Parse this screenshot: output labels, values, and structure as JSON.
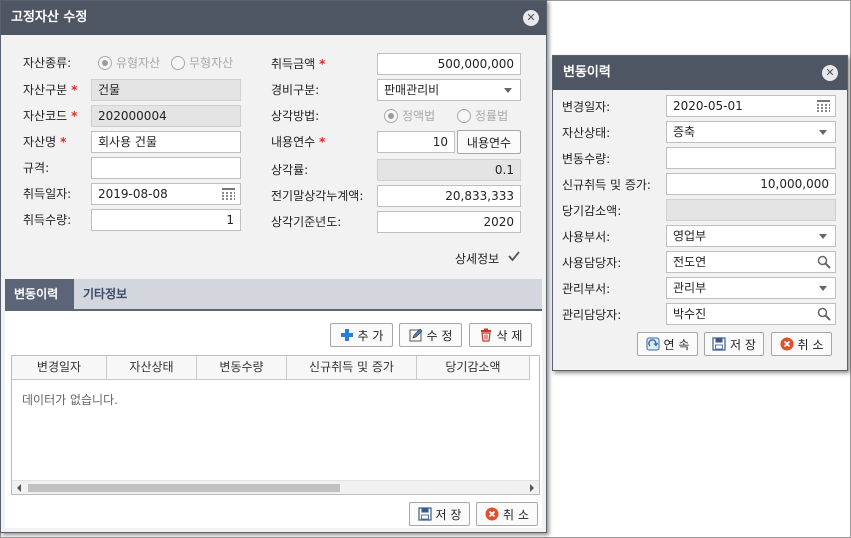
{
  "main_dialog": {
    "title": "고정자산 수정",
    "left_fields": {
      "asset_type_label": "자산종류:",
      "asset_type_options": [
        "유형자산",
        "무형자산"
      ],
      "asset_class_label": "자산구분",
      "asset_class_value": "건물",
      "asset_code_label": "자산코드",
      "asset_code_value": "202000004",
      "asset_name_label": "자산명",
      "asset_name_value": "회사용 건물",
      "spec_label": "규격:",
      "spec_value": "",
      "acq_date_label": "취득일자:",
      "acq_date_value": "2019-08-08",
      "acq_qty_label": "취득수량:",
      "acq_qty_value": "1"
    },
    "right_fields": {
      "acq_amount_label": "취득금액",
      "acq_amount_value": "500,000,000",
      "expense_label": "경비구분:",
      "expense_value": "판매관리비",
      "depr_method_label": "상각방법:",
      "depr_method_options": [
        "정액법",
        "정률법"
      ],
      "useful_life_label": "내용연수",
      "useful_life_value": "10",
      "useful_life_button": "내용연수",
      "depr_rate_label": "상각률:",
      "depr_rate_value": "0.1",
      "accum_depr_label": "전기말상각누계액:",
      "accum_depr_value": "20,833,333",
      "depr_base_year_label": "상각기준년도:",
      "depr_base_year_value": "2020"
    },
    "detail_label": "상세정보",
    "tabs": [
      "변동이력",
      "기타정보"
    ],
    "grid_buttons": {
      "add": "추 가",
      "edit": "수 정",
      "delete": "삭 제"
    },
    "grid_columns": [
      "변경일자",
      "자산상태",
      "변동수량",
      "신규취득 및 증가",
      "당기감소액"
    ],
    "grid_empty": "데이터가 없습니다.",
    "footer": {
      "save": "저 장",
      "cancel": "취 소"
    }
  },
  "history_dialog": {
    "title": "변동이력",
    "fields": [
      {
        "label": "변경일자:",
        "value": "2020-05-01",
        "kind": "date"
      },
      {
        "label": "자산상태:",
        "value": "증축",
        "kind": "select"
      },
      {
        "label": "변동수량:",
        "value": "",
        "kind": "text"
      },
      {
        "label": "신규취득 및 증가:",
        "value": "10,000,000",
        "kind": "number"
      },
      {
        "label": "당기감소액:",
        "value": "",
        "kind": "disabled"
      },
      {
        "label": "사용부서:",
        "value": "영업부",
        "kind": "select"
      },
      {
        "label": "사용담당자:",
        "value": "전도연",
        "kind": "search"
      },
      {
        "label": "관리부서:",
        "value": "관리부",
        "kind": "select"
      },
      {
        "label": "관리담당자:",
        "value": "박수진",
        "kind": "search"
      }
    ],
    "buttons": {
      "continue": "연 속",
      "save": "저 장",
      "cancel": "취 소"
    }
  },
  "colors": {
    "titlebar": "#4e5563",
    "required": "#e0282a",
    "tab_active": "#5c6577",
    "add_icon": "#2a7fd0",
    "cancel_icon": "#e04e2c"
  }
}
